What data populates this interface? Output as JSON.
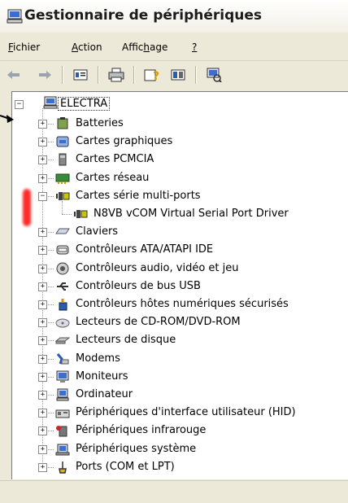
{
  "window": {
    "title": "Gestionnaire de périphériques",
    "title_icon": "computer-icon"
  },
  "menu": [
    {
      "label": "Fichier",
      "accel": "F"
    },
    {
      "label": "Action",
      "accel": "A"
    },
    {
      "label": "Affichage",
      "accel": "h"
    },
    {
      "label": "?",
      "accel": "?"
    }
  ],
  "toolbar": {
    "buttons": [
      "back-arrow-icon",
      "forward-arrow-icon",
      "properties-icon",
      "print-icon",
      "help-icon",
      "toggle-view-icon",
      "scan-hardware-icon"
    ]
  },
  "tree": {
    "root": {
      "label": "ELECTRA",
      "icon": "computer-icon",
      "expanded": true,
      "selected": true
    },
    "items": [
      {
        "label": "Batteries",
        "icon": "battery-icon",
        "expanded": false
      },
      {
        "label": "Cartes graphiques",
        "icon": "display-adapter-icon",
        "expanded": false
      },
      {
        "label": "Cartes PCMCIA",
        "icon": "pcmcia-icon",
        "expanded": false
      },
      {
        "label": "Cartes réseau",
        "icon": "network-card-icon",
        "expanded": false
      },
      {
        "label": "Cartes série multi-ports",
        "icon": "serial-port-icon",
        "expanded": true,
        "children": [
          {
            "label": "N8VB vCOM Virtual Serial Port Driver",
            "icon": "serial-port-icon"
          }
        ]
      },
      {
        "label": "Claviers",
        "icon": "keyboard-icon",
        "expanded": false
      },
      {
        "label": "Contrôleurs ATA/ATAPI IDE",
        "icon": "ide-controller-icon",
        "expanded": false
      },
      {
        "label": "Contrôleurs audio, vidéo et jeu",
        "icon": "speaker-icon",
        "expanded": false
      },
      {
        "label": "Contrôleurs de bus USB",
        "icon": "usb-icon",
        "expanded": false
      },
      {
        "label": "Contrôleurs hôtes numériques sécurisés",
        "icon": "sd-host-icon",
        "expanded": false
      },
      {
        "label": "Lecteurs de CD-ROM/DVD-ROM",
        "icon": "cdrom-icon",
        "expanded": false
      },
      {
        "label": "Lecteurs de disque",
        "icon": "disk-drive-icon",
        "expanded": false
      },
      {
        "label": "Modems",
        "icon": "modem-icon",
        "expanded": false
      },
      {
        "label": "Moniteurs",
        "icon": "monitor-icon",
        "expanded": false
      },
      {
        "label": "Ordinateur",
        "icon": "computer-small-icon",
        "expanded": false
      },
      {
        "label": "Périphériques d'interface utilisateur (HID)",
        "icon": "hid-icon",
        "expanded": false
      },
      {
        "label": "Périphériques infrarouge",
        "icon": "infrared-icon",
        "expanded": false
      },
      {
        "label": "Périphériques système",
        "icon": "system-device-icon",
        "expanded": false
      },
      {
        "label": "Ports (COM et LPT)",
        "icon": "port-icon",
        "expanded": false
      }
    ]
  },
  "colors": {
    "chrome": "#ece9d8",
    "annotation_mark": "#ff2a2a"
  }
}
